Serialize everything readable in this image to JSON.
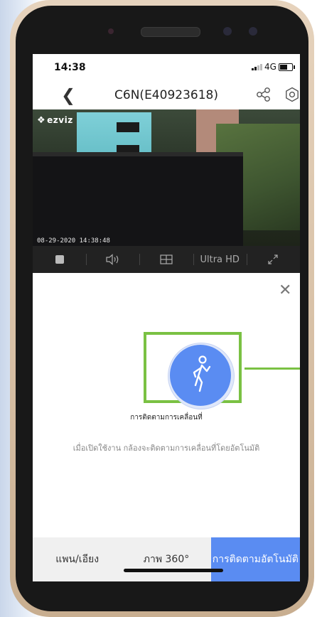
{
  "status_bar": {
    "time": "14:38",
    "network": "4G"
  },
  "header": {
    "title": "C6N(E40923618)"
  },
  "video": {
    "brand": "ezviz",
    "timestamp": "08-29-2020 14:38:48"
  },
  "controls": {
    "quality": "Ultra HD"
  },
  "feature": {
    "label": "การติดตามการเคลื่อนที่",
    "description": "เมื่อเปิดใช้งาน กล้องจะติดตามการเคลื่อนที่โดยอัตโนมัติ"
  },
  "tabs": [
    {
      "label": "แพน/เอียง"
    },
    {
      "label": "ภาพ 360°"
    },
    {
      "label": "การติดตามอัตโนมัติ"
    }
  ],
  "colors": {
    "accent": "#5a8cf2",
    "highlight": "#7ac143"
  }
}
